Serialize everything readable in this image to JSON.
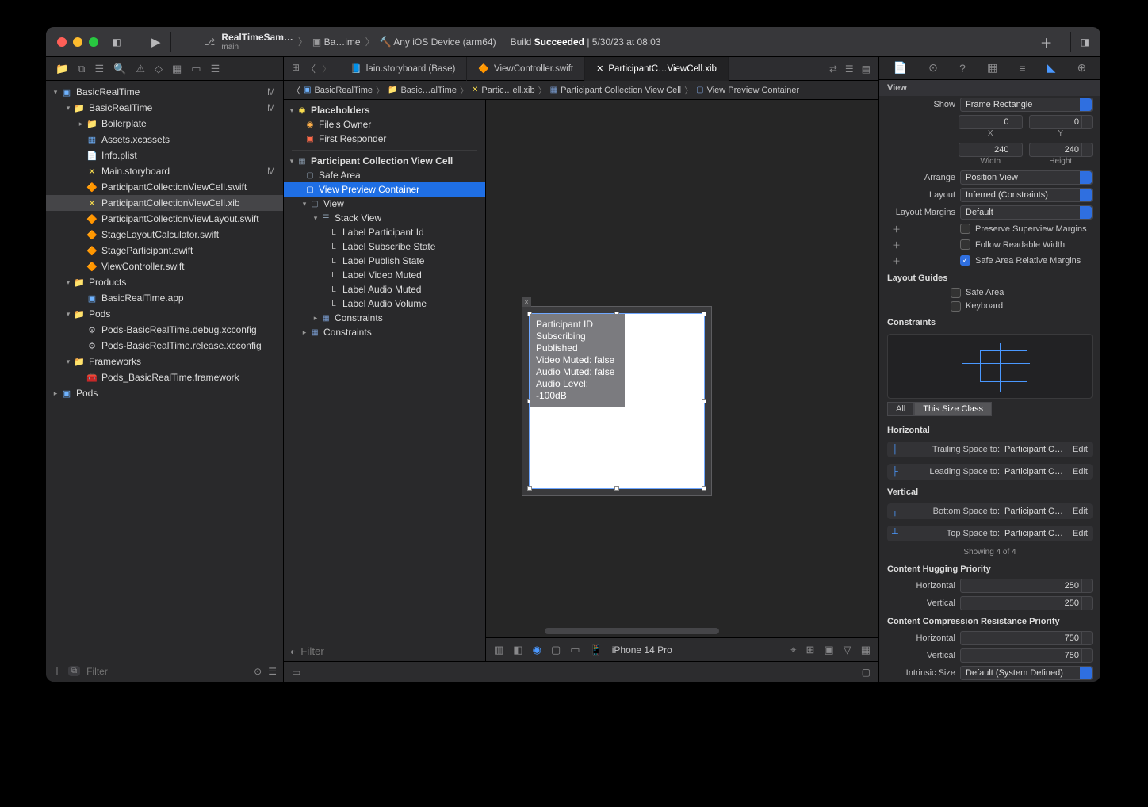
{
  "toolbar": {
    "scheme": "RealTimeSam…",
    "branch": "main",
    "target_prefix": "Ba…ime",
    "destination": "Any iOS Device (arm64)",
    "status_prefix": "Build ",
    "status_bold": "Succeeded",
    "status_suffix": " | 5/30/23 at 08:03"
  },
  "tabs": [
    {
      "icon": "📘",
      "label": "lain.storyboard (Base)",
      "active": false
    },
    {
      "icon": "🔶",
      "label": "ViewController.swift",
      "active": false
    },
    {
      "icon": "✕",
      "label": "ParticipantC…ViewCell.xib",
      "active": true
    }
  ],
  "jump": {
    "p1": "BasicRealTime",
    "p2": "Basic…alTime",
    "p3": "Partic…ell.xib",
    "p4": "Participant Collection View Cell",
    "p5": "View Preview Container"
  },
  "navigator": {
    "root": "BasicRealTime",
    "items": [
      {
        "ind": 1,
        "disc": "▾",
        "icon": "📁",
        "cls": "blue",
        "label": "BasicRealTime",
        "m": "M"
      },
      {
        "ind": 2,
        "disc": "▸",
        "icon": "📁",
        "cls": "gray",
        "label": "Boilerplate"
      },
      {
        "ind": 2,
        "disc": "",
        "icon": "▦",
        "cls": "bluebox",
        "label": "Assets.xcassets"
      },
      {
        "ind": 2,
        "disc": "",
        "icon": "📄",
        "cls": "gray",
        "label": "Info.plist"
      },
      {
        "ind": 2,
        "disc": "",
        "icon": "✕",
        "cls": "ylw",
        "label": "Main.storyboard",
        "m": "M"
      },
      {
        "ind": 2,
        "disc": "",
        "icon": "🔶",
        "cls": "orange",
        "label": "ParticipantCollectionViewCell.swift"
      },
      {
        "ind": 2,
        "disc": "",
        "icon": "✕",
        "cls": "ylw",
        "label": "ParticipantCollectionViewCell.xib",
        "sel": true
      },
      {
        "ind": 2,
        "disc": "",
        "icon": "🔶",
        "cls": "orange",
        "label": "ParticipantCollectionViewLayout.swift"
      },
      {
        "ind": 2,
        "disc": "",
        "icon": "🔶",
        "cls": "orange",
        "label": "StageLayoutCalculator.swift"
      },
      {
        "ind": 2,
        "disc": "",
        "icon": "🔶",
        "cls": "orange",
        "label": "StageParticipant.swift"
      },
      {
        "ind": 2,
        "disc": "",
        "icon": "🔶",
        "cls": "orange",
        "label": "ViewController.swift"
      },
      {
        "ind": 1,
        "disc": "▾",
        "icon": "📁",
        "cls": "gray",
        "label": "Products"
      },
      {
        "ind": 2,
        "disc": "",
        "icon": "▣",
        "cls": "bluebox",
        "label": "BasicRealTime.app"
      },
      {
        "ind": 1,
        "disc": "▾",
        "icon": "📁",
        "cls": "gray",
        "label": "Pods"
      },
      {
        "ind": 2,
        "disc": "",
        "icon": "⚙",
        "cls": "gray",
        "label": "Pods-BasicRealTime.debug.xcconfig"
      },
      {
        "ind": 2,
        "disc": "",
        "icon": "⚙",
        "cls": "gray",
        "label": "Pods-BasicRealTime.release.xcconfig"
      },
      {
        "ind": 1,
        "disc": "▾",
        "icon": "📁",
        "cls": "gray",
        "label": "Frameworks"
      },
      {
        "ind": 2,
        "disc": "",
        "icon": "🧰",
        "cls": "ylw",
        "label": "Pods_BasicRealTime.framework"
      },
      {
        "ind": 0,
        "disc": "▸",
        "icon": "▣",
        "cls": "bluebox",
        "label": "Pods"
      }
    ],
    "filter_placeholder": "Filter"
  },
  "outline": {
    "placeholders": "Placeholders",
    "files_owner": "File's Owner",
    "first_responder": "First Responder",
    "cell": "Participant Collection View Cell",
    "safe_area": "Safe Area",
    "preview_container": "View Preview Container",
    "view": "View",
    "stack": "Stack View",
    "labels": [
      "Label Participant Id",
      "Label Subscribe State",
      "Label Publish State",
      "Label Video Muted",
      "Label Audio Muted",
      "Label Audio Volume"
    ],
    "constraints": "Constraints",
    "filter_placeholder": "Filter"
  },
  "canvas": {
    "device": "iPhone 14 Pro",
    "labels": [
      "Participant ID",
      "Subscribing",
      "Published",
      "Video Muted: false",
      "Audio Muted: false",
      "Audio Level: -100dB"
    ]
  },
  "inspector": {
    "view_title": "View",
    "show_label": "Show",
    "show_val": "Frame Rectangle",
    "x": "0",
    "y": "0",
    "x_lab": "X",
    "y_lab": "Y",
    "w": "240",
    "h": "240",
    "w_lab": "Width",
    "h_lab": "Height",
    "arrange_label": "Arrange",
    "arrange_val": "Position View",
    "layout_label": "Layout",
    "layout_val": "Inferred (Constraints)",
    "margins_label": "Layout Margins",
    "margins_val": "Default",
    "preserve": "Preserve Superview Margins",
    "follow": "Follow Readable Width",
    "safearea": "Safe Area Relative Margins",
    "guides_title": "Layout Guides",
    "guide_safe": "Safe Area",
    "guide_kb": "Keyboard",
    "constraints_title": "Constraints",
    "seg_all": "All",
    "seg_this": "This Size Class",
    "horiz": "Horizontal",
    "vert": "Vertical",
    "c": [
      {
        "lab": "Trailing Space to:",
        "val": "Participant Colle…"
      },
      {
        "lab": "Leading Space to:",
        "val": "Participant Colle…"
      },
      {
        "lab": "Bottom Space to:",
        "val": "Participant Colle…"
      },
      {
        "lab": "Top Space to:",
        "val": "Participant Colle…"
      }
    ],
    "edit": "Edit",
    "showing": "Showing 4 of 4",
    "hug_title": "Content Hugging Priority",
    "hug_h_lab": "Horizontal",
    "hug_h": "250",
    "hug_v_lab": "Vertical",
    "hug_v": "250",
    "comp_title": "Content Compression Resistance Priority",
    "comp_h_lab": "Horizontal",
    "comp_h": "750",
    "comp_v_lab": "Vertical",
    "comp_v": "750",
    "intrinsic_lab": "Intrinsic Size",
    "intrinsic_val": "Default (System Defined)"
  }
}
